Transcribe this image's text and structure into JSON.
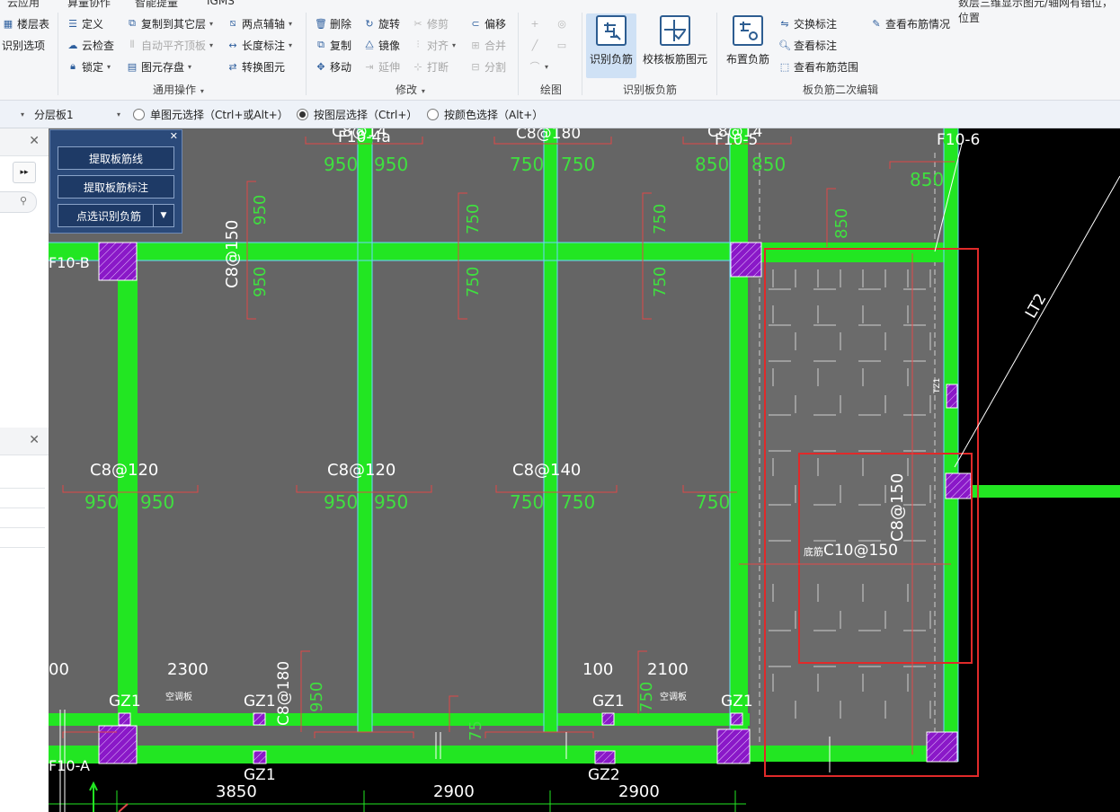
{
  "menubar": {
    "items": [
      "云应用",
      "算量协作",
      "智能提量",
      "IGMS"
    ],
    "right_text": "数层三维显示图元/轴网有错位，位置"
  },
  "ribbon": {
    "left_partial": [
      "楼层表",
      "识别选项"
    ],
    "general_ops": {
      "col1": [
        "定义",
        "云检查",
        "锁定"
      ],
      "col2": [
        "复制到其它层",
        "自动平齐顶板",
        "图元存盘"
      ],
      "col3": [
        "两点辅轴",
        "长度标注",
        "转换图元"
      ],
      "label": "通用操作"
    },
    "modify": {
      "col1": [
        "删除",
        "复制",
        "移动"
      ],
      "col2": [
        "旋转",
        "镜像",
        "延伸"
      ],
      "col3": [
        "修剪",
        "对齐",
        "打断"
      ],
      "col4": [
        "偏移",
        "合并",
        "分割"
      ],
      "label": "修改"
    },
    "draw": {
      "label": "绘图"
    },
    "recognize": {
      "btn1": "识别负筋",
      "btn2": "校核板筋图元",
      "label": "识别板负筋"
    },
    "edit2": {
      "big": "布置负筋",
      "col1": [
        "交换标注",
        "查看标注",
        "查看布筋范围"
      ],
      "col2": [
        "查看布筋情况"
      ],
      "label": "板负筋二次编辑"
    }
  },
  "toolbar2": {
    "layer_combo": "分层板1",
    "radio1": "单图元选择（Ctrl+或Alt+）",
    "radio2": "按图层选择（Ctrl+）",
    "radio3": "按颜色选择（Alt+）",
    "selected": 2
  },
  "float_panel": {
    "btn1": "提取板筋线",
    "btn2": "提取板筋标注",
    "btn3": "点选识别负筋"
  },
  "drawing": {
    "axis_labels": {
      "a": "F10-4a",
      "b": "F10-5",
      "c": "F10-6",
      "d": "F10-B",
      "e": "F10-A"
    },
    "top_labels": [
      "C8@14",
      "C8@180",
      "C8@14"
    ],
    "top_nums": [
      "950",
      "950",
      "750",
      "750",
      "850",
      "850",
      "850"
    ],
    "vert_nums": [
      "950",
      "950",
      "750",
      "750",
      "750",
      "750",
      "850"
    ],
    "vert_rebar": "C8@150",
    "mid_labels": [
      "C8@120",
      "C8@120",
      "C8@140"
    ],
    "mid_nums": [
      "950",
      "950",
      "950",
      "950",
      "750",
      "750",
      "750"
    ],
    "right_rebar_v": "C8@150",
    "right_rebar_h": "C10@150",
    "right_rebar_h_prefix": "底筋",
    "lt_label": "LT2",
    "tz_label": "TZ1",
    "bottom": {
      "n00": "00",
      "n2300": "2300",
      "n100": "100",
      "n2100": "2100",
      "gz": [
        "GZ1",
        "GZ1",
        "GZ1",
        "GZ1",
        "GZ1",
        "GZ2"
      ],
      "kong": "空调板",
      "c8180": "C8@180",
      "n950": "950",
      "n750": "750",
      "n75": "75",
      "dims": [
        "3850",
        "2900",
        "2900"
      ]
    }
  }
}
